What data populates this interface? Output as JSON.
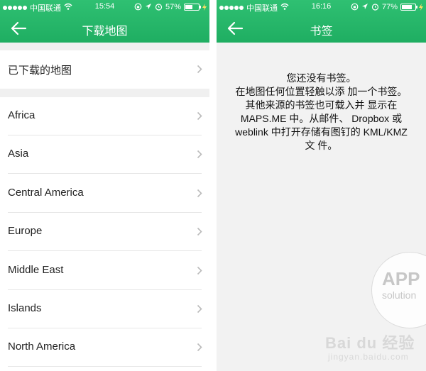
{
  "left": {
    "status": {
      "carrier": "中国联通",
      "time": "15:54",
      "battery": "57%",
      "battery_level": 0.57
    },
    "nav": {
      "title": "下载地图"
    },
    "downloaded": {
      "label": "已下载的地图"
    },
    "regions": [
      {
        "label": "Africa"
      },
      {
        "label": "Asia"
      },
      {
        "label": "Central America"
      },
      {
        "label": "Europe"
      },
      {
        "label": "Middle East"
      },
      {
        "label": "Islands"
      },
      {
        "label": "North America"
      }
    ]
  },
  "right": {
    "status": {
      "carrier": "中国联通",
      "time": "16:16",
      "battery": "77%",
      "battery_level": 0.77
    },
    "nav": {
      "title": "书签"
    },
    "message": [
      "您还没有书签。",
      "在地图任何位置轻触以添 加一个书签。",
      "其他来源的书签也可载入并 显示在",
      "MAPS.ME 中。从邮件、 Dropbox 或",
      "weblink 中打开存储有图钉的 KML/KMZ",
      "文 件。"
    ]
  },
  "watermarks": {
    "app_line1": "APP",
    "app_line2": "solution",
    "baidu_logo": "Bai du",
    "baidu_suffix": "经验",
    "baidu_url": "jingyan.baidu.com"
  },
  "colors": {
    "accent": "#1fae62",
    "background": "#f2f2f2"
  }
}
